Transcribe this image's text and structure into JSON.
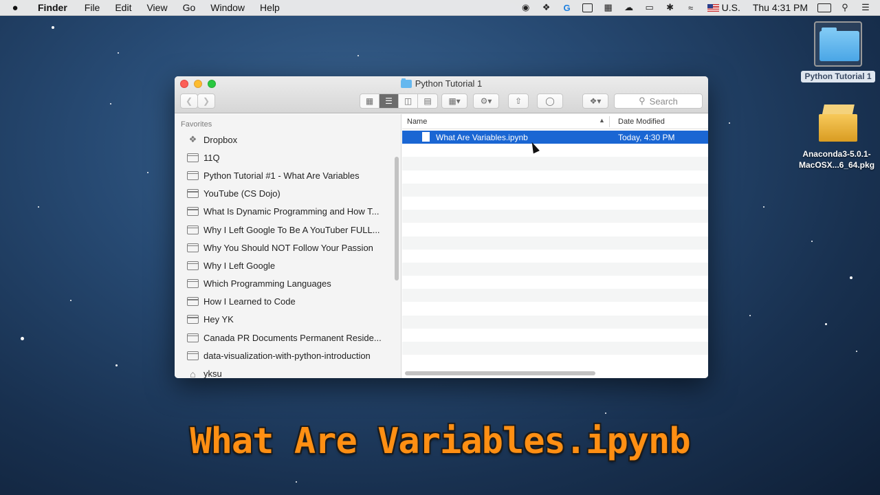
{
  "menubar": {
    "apple": "",
    "items": [
      "Finder",
      "File",
      "Edit",
      "View",
      "Go",
      "Window",
      "Help"
    ],
    "input_source": "U.S.",
    "clock": "Thu 4:31 PM"
  },
  "window": {
    "title": "Python Tutorial 1",
    "search_placeholder": "Search",
    "sidebar": {
      "heading": "Favorites",
      "items": [
        "Dropbox",
        "11Q",
        "Python Tutorial #1 - What Are Variables",
        "YouTube (CS Dojo)",
        "What Is Dynamic Programming and How T...",
        "Why I Left Google To Be A YouTuber FULL...",
        "Why You Should NOT Follow Your Passion",
        "Why I Left Google",
        "Which Programming Languages",
        "How I Learned to Code",
        "Hey YK",
        "Canada PR Documents Permanent Reside...",
        "data-visualization-with-python-introduction",
        "yksu"
      ]
    },
    "columns": {
      "name": "Name",
      "date": "Date Modified"
    },
    "files": [
      {
        "name": "What Are Variables.ipynb",
        "date": "Today, 4:30 PM"
      }
    ]
  },
  "desktop": {
    "folder_label": "Python Tutorial 1",
    "pkg_label": "Anaconda3-5.0.1-MacOSX...6_64.pkg"
  },
  "caption": "What Are Variables.ipynb"
}
